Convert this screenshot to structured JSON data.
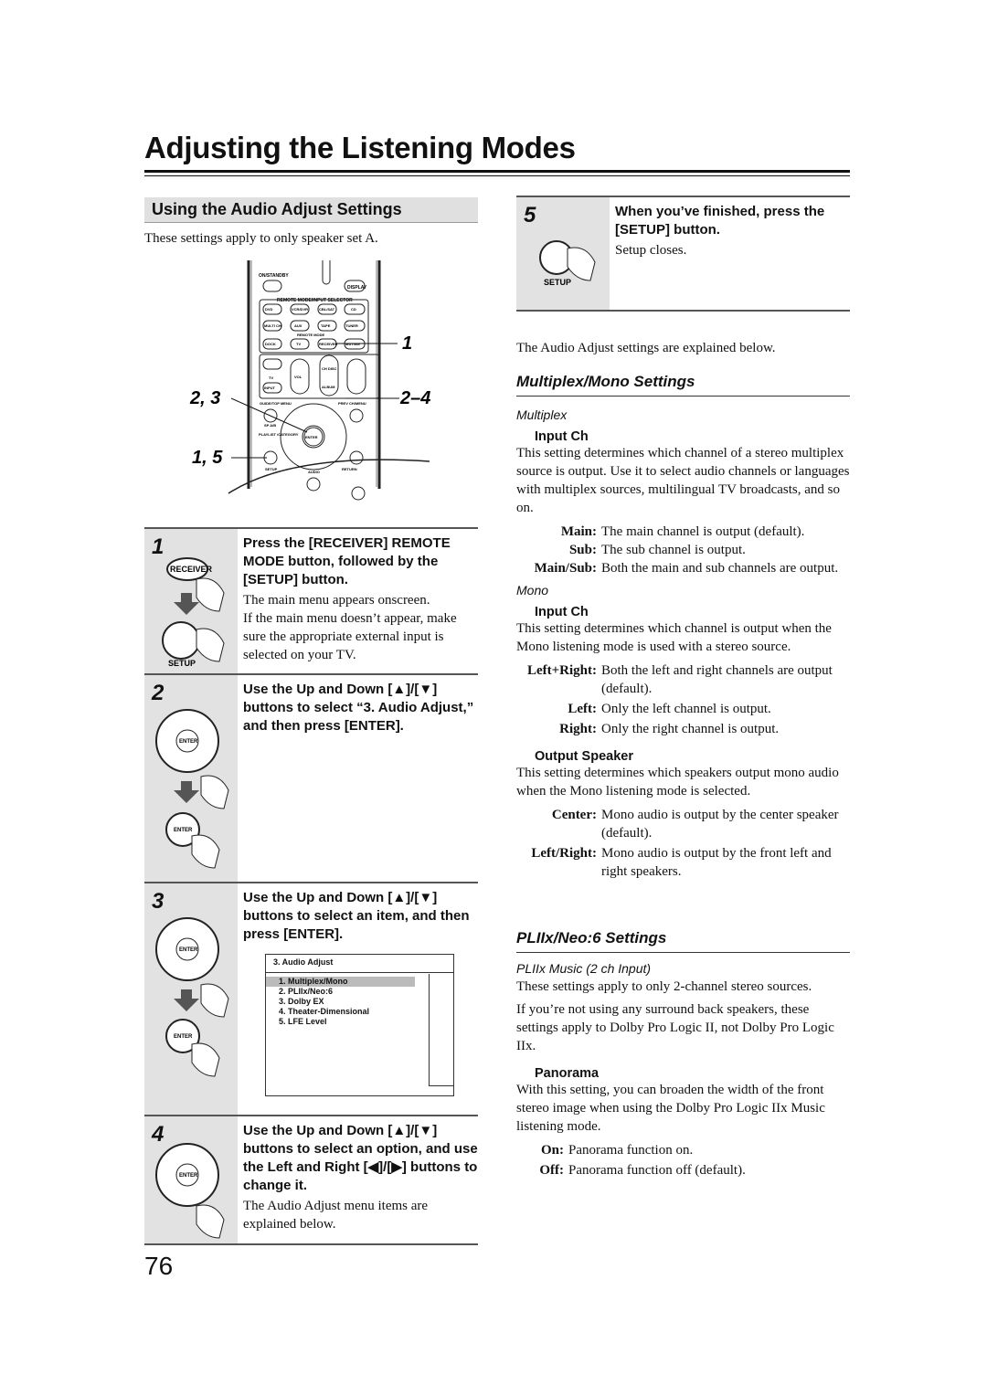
{
  "title": "Adjusting the Listening Modes",
  "section": "Using the Audio Adjust Settings",
  "intro": "These settings apply to only speaker set A.",
  "remote": {
    "callouts": [
      "1",
      "2, 3",
      "2–4",
      "1, 5"
    ],
    "buttons": {
      "on_standby": "ON/STANDBY",
      "display": "DISPLAY",
      "selector": "REMOTE MODE/INPUT SELECTOR",
      "dvd": "DVD",
      "vcr": "VCR/DVR",
      "cbl": "CBL/SAT",
      "cd": "CD",
      "multi": "MULTI CH",
      "aux": "AUX",
      "tape": "TAPE",
      "tuner": "TUNER",
      "remote_mode": "REMOTE MODE",
      "dock": "DOCK",
      "tv": "TV",
      "receiver": "RECEIVER",
      "muting": "MUTING",
      "tv2": "TV",
      "vol": "VOL",
      "ch": "CH DISC",
      "album": "ALBUM",
      "input": "INPUT",
      "guide": "GUIDE/TOP MENU",
      "prev": "PREV CH/MENU",
      "spab": "SP A/B",
      "playlist": "PLAYLIST /CATEGORY",
      "enter": "ENTER",
      "setup": "SETUP",
      "audio": "AUDIO",
      "return": "RETURN"
    }
  },
  "steps": [
    {
      "num": "1",
      "instruction": "Press the [RECEIVER] REMOTE MODE button, followed by the [SETUP] button.",
      "notes": [
        "The main menu appears onscreen.",
        "If the main menu doesn’t appear, make sure the appropriate external input is selected on your TV."
      ],
      "icon_labels": [
        "RECEIVER",
        "SETUP"
      ]
    },
    {
      "num": "2",
      "instruction": "Use the Up and Down [▲]/[▼] buttons to select “3. Audio Adjust,” and then press [ENTER].",
      "icon_labels": [
        "ENTER",
        "ENTER"
      ]
    },
    {
      "num": "3",
      "instruction": "Use the Up and Down [▲]/[▼] buttons to select an item, and then press [ENTER].",
      "icon_labels": [
        "ENTER",
        "ENTER"
      ],
      "menu": {
        "title": "3.  Audio Adjust",
        "items": [
          "1.  Multiplex/Mono",
          "2.  PLIIx/Neo:6",
          "3.  Dolby EX",
          "4.  Theater-Dimensional",
          "5.  LFE Level"
        ],
        "selected": 0
      }
    },
    {
      "num": "4",
      "instruction": "Use the Up and Down [▲]/[▼] buttons to select an option, and use the Left and Right [◀]/[▶] buttons to change it.",
      "notes": [
        "The Audio Adjust menu items are explained below."
      ],
      "icon_labels": [
        "ENTER"
      ]
    },
    {
      "num": "5",
      "instruction": "When you’ve finished, press the [SETUP] button.",
      "notes": [
        "Setup closes."
      ],
      "icon_labels": [
        "SETUP"
      ]
    }
  ],
  "explained": "The Audio Adjust settings are explained below.",
  "multiplex_mono": {
    "heading": "Multiplex/Mono Settings",
    "multiplex": {
      "label": "Multiplex",
      "input_ch": "Input Ch",
      "desc": "This setting determines which channel of a stereo multiplex source is output. Use it to select audio channels or languages with multiplex sources, multilingual TV broadcasts, and so on.",
      "options": [
        {
          "t": "Main:",
          "d": "The main channel is output (default)."
        },
        {
          "t": "Sub:",
          "d": "The sub channel is output."
        },
        {
          "t": "Main/Sub:",
          "d": "Both the main and sub channels are output."
        }
      ]
    },
    "mono": {
      "label": "Mono",
      "input_ch": "Input Ch",
      "desc": "This setting determines which channel is output when the Mono listening mode is used with a stereo source.",
      "options": [
        {
          "t": "Left+Right:",
          "d": "Both the left and right channels are output (default)."
        },
        {
          "t": "Left:",
          "d": "Only the left channel is output."
        },
        {
          "t": "Right:",
          "d": "Only the right channel is output."
        }
      ],
      "output_speaker": "Output Speaker",
      "os_desc": "This setting determines which speakers output mono audio when the Mono listening mode is selected.",
      "os_options": [
        {
          "t": "Center:",
          "d": "Mono audio is output by the center speaker (default)."
        },
        {
          "t": "Left/Right:",
          "d": "Mono audio is output by the front left and right speakers."
        }
      ]
    }
  },
  "pliix": {
    "heading": "PLIIx/Neo:6 Settings",
    "sub": "PLIIx Music (2 ch Input)",
    "p1": "These settings apply to only 2-channel stereo sources.",
    "p2": "If you’re not using any surround back speakers, these settings apply to Dolby Pro Logic II, not Dolby Pro Logic IIx.",
    "panorama": "Panorama",
    "pan_desc": "With this setting, you can broaden the width of the front stereo image when using the Dolby Pro Logic IIx Music listening mode.",
    "options": [
      {
        "t": "On:",
        "d": "Panorama function on."
      },
      {
        "t": "Off:",
        "d": "Panorama function off (default)."
      }
    ]
  },
  "page_number": "76"
}
